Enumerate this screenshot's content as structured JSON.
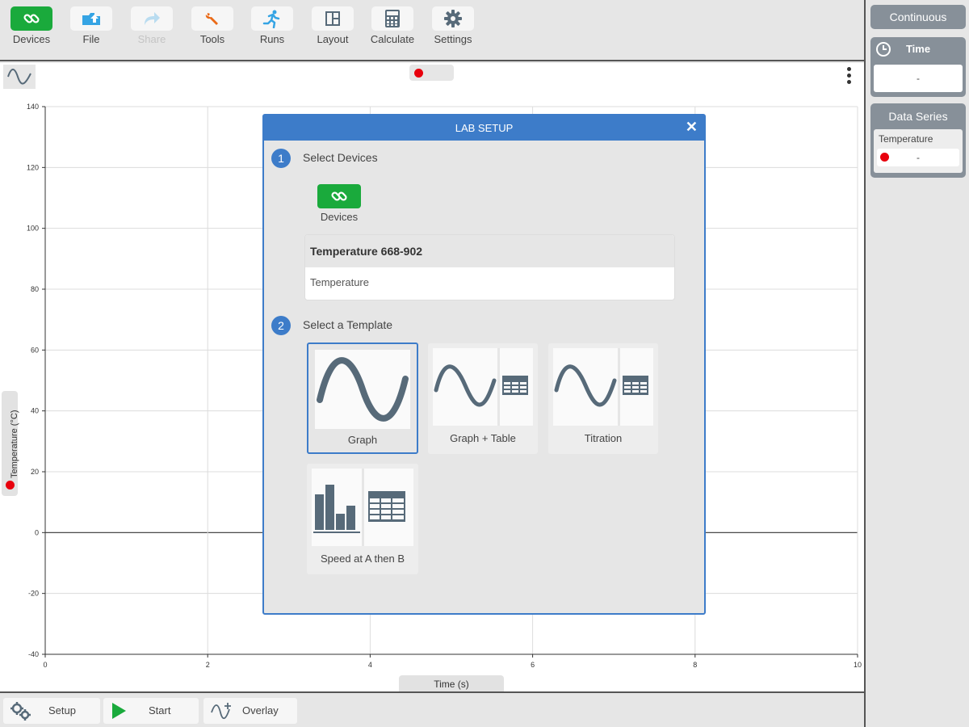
{
  "toolbar": {
    "items": [
      {
        "label": "Devices",
        "icon": "link-icon",
        "state": "active"
      },
      {
        "label": "File",
        "icon": "folder-icon",
        "state": "normal"
      },
      {
        "label": "Share",
        "icon": "share-icon",
        "state": "disabled"
      },
      {
        "label": "Tools",
        "icon": "wrench-icon",
        "state": "normal"
      },
      {
        "label": "Runs",
        "icon": "runner-icon",
        "state": "normal"
      },
      {
        "label": "Layout",
        "icon": "layout-icon",
        "state": "normal"
      },
      {
        "label": "Calculate",
        "icon": "calculator-icon",
        "state": "normal"
      },
      {
        "label": "Settings",
        "icon": "gear-icon",
        "state": "normal"
      }
    ]
  },
  "right_panel": {
    "mode_label": "Continuous",
    "time_label": "Time",
    "time_value": "-",
    "data_series_label": "Data Series",
    "series_name": "Temperature",
    "series_value": "-"
  },
  "graph": {
    "y_axis_label": "Temperature (°C)",
    "x_axis_label": "Time (s)"
  },
  "chart_data": {
    "type": "line",
    "title": "",
    "xlabel": "Time (s)",
    "ylabel": "Temperature (°C)",
    "xlim": [
      0,
      10
    ],
    "ylim": [
      -40,
      140
    ],
    "x_ticks": [
      0,
      2,
      4,
      6,
      8,
      10
    ],
    "y_ticks": [
      -40,
      -20,
      0,
      20,
      40,
      60,
      80,
      100,
      120,
      140
    ],
    "grid": true,
    "series": []
  },
  "bottom_bar": {
    "setup_label": "Setup",
    "start_label": "Start",
    "overlay_label": "Overlay"
  },
  "dialog": {
    "title": "LAB SETUP",
    "close_glyph": "✕",
    "step1_number": "1",
    "step1_label": "Select Devices",
    "devices_button_label": "Devices",
    "device_name": "Temperature 668-902",
    "device_sensor": "Temperature",
    "step2_number": "2",
    "step2_label": "Select a Template",
    "templates": [
      {
        "label": "Graph",
        "selected": true
      },
      {
        "label": "Graph + Table",
        "selected": false
      },
      {
        "label": "Titration",
        "selected": false
      },
      {
        "label": "Speed at A then B",
        "selected": false
      }
    ]
  },
  "colors": {
    "accent_blue": "#3d7cc9",
    "device_green": "#1aaa3c",
    "record_red": "#e8000d",
    "icon_slate": "#576a79"
  }
}
